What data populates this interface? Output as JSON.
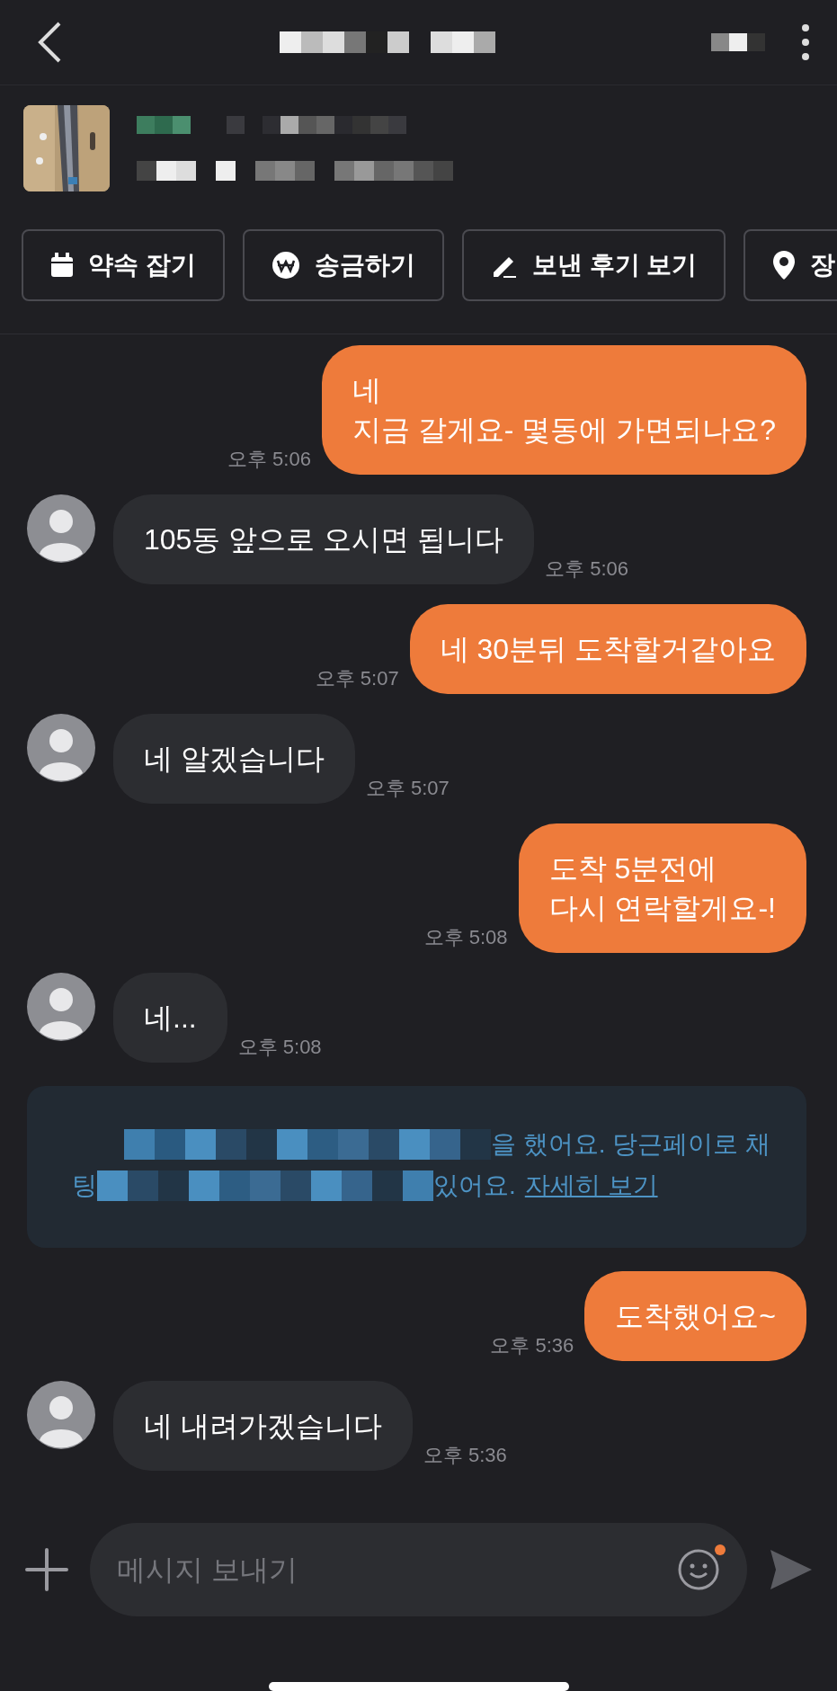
{
  "actions": [
    {
      "kind": "calendar",
      "label": "약속 잡기"
    },
    {
      "kind": "won",
      "label": "송금하기"
    },
    {
      "kind": "pencil",
      "label": "보낸 후기 보기"
    },
    {
      "kind": "pin",
      "label": "장"
    }
  ],
  "messages": [
    {
      "kind": "sent",
      "text": "네\n지금 갈게요- 몇동에 가면되나요?",
      "time": "오후 5:06"
    },
    {
      "kind": "received",
      "text": "105동 앞으로 오시면 됩니다",
      "time": "오후 5:06"
    },
    {
      "kind": "sent",
      "text": "네 30분뒤 도착할거같아요",
      "time": "오후 5:07"
    },
    {
      "kind": "received",
      "text": "네 알겠습니다",
      "time": "오후 5:07"
    },
    {
      "kind": "sent",
      "text": "도착 5분전에\n다시 연락할게요-!",
      "time": "오후 5:08"
    },
    {
      "kind": "received",
      "text": "네...",
      "time": "오후 5:08"
    },
    {
      "kind": "notice",
      "line1_end": "을 했어요. 당근페이로 채",
      "line2_start": "팅",
      "line2_end": "있어요.",
      "link": "자세히 보기"
    },
    {
      "kind": "sent",
      "text": "도착했어요~",
      "time": "오후 5:36"
    },
    {
      "kind": "received",
      "text": "네 내려가겠습니다",
      "time": "오후 5:36"
    }
  ],
  "input": {
    "placeholder": "메시지 보내기",
    "emoji_badge": true
  }
}
